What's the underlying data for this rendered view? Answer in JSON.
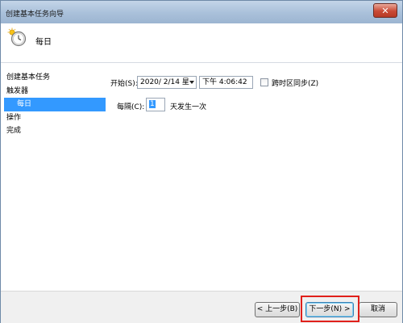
{
  "window": {
    "title": "创建基本任务向导",
    "close_glyph": "✕"
  },
  "header": {
    "title": "每日",
    "icon": "clock-sun-icon"
  },
  "nav": {
    "items": [
      {
        "label": "创建基本任务",
        "selected": false
      },
      {
        "label": "触发器",
        "selected": false
      },
      {
        "label": "每日",
        "selected": true,
        "sub": true
      },
      {
        "label": "操作",
        "selected": false
      },
      {
        "label": "完成",
        "selected": false
      }
    ]
  },
  "trigger": {
    "start_label": "开始(S):",
    "date_value": "2020/  2/14 星",
    "time_value": "下午    4:06:42",
    "sync_label": "跨时区同步(Z)",
    "sync_checked": false,
    "recur_label": "每隔(C):",
    "recur_value": "1",
    "recur_suffix": "天发生一次"
  },
  "footer": {
    "back_label": "< 上一步(B)",
    "next_label": "下一步(N) >",
    "cancel_label": "取消"
  },
  "colors": {
    "selection": "#3399ff",
    "highlight_box": "#e0201b"
  }
}
